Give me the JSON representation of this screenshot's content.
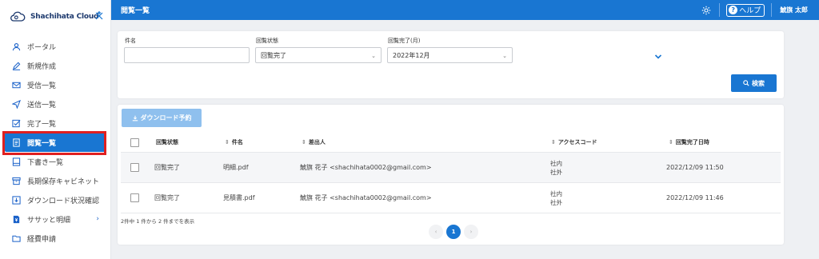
{
  "brand": {
    "name": "Shachihata Cloud"
  },
  "sidebar": {
    "items": [
      {
        "label": "ポータル",
        "icon": "user-icon"
      },
      {
        "label": "新規作成",
        "icon": "pencil-icon"
      },
      {
        "label": "受信一覧",
        "icon": "envelope-icon"
      },
      {
        "label": "送信一覧",
        "icon": "send-icon"
      },
      {
        "label": "完了一覧",
        "icon": "check-square-icon"
      },
      {
        "label": "閲覧一覧",
        "icon": "document-icon"
      },
      {
        "label": "下書き一覧",
        "icon": "draft-icon"
      },
      {
        "label": "長期保存キャビネット",
        "icon": "cabinet-icon"
      },
      {
        "label": "ダウンロード状況確認",
        "icon": "download-box-icon"
      },
      {
        "label": "ササッと明細",
        "icon": "file-yen-icon"
      },
      {
        "label": "経費申請",
        "icon": "folder-icon"
      }
    ],
    "active_index": 5
  },
  "header": {
    "title": "閲覧一覧",
    "help_label": "ヘルプ",
    "user_name": "鯱旗 太郎"
  },
  "search": {
    "subject_label": "件名",
    "subject_value": "",
    "status_label": "回覧状態",
    "status_value": "回覧完了",
    "completed_label": "回覧完了(月)",
    "completed_value": "2022年12月",
    "search_button": "検索"
  },
  "results": {
    "download_button": "ダウンロード予約",
    "columns": [
      "回覧状態",
      "件名",
      "差出人",
      "アクセスコード",
      "回覧完了日時"
    ],
    "rows": [
      {
        "status": "回覧完了",
        "subject": "明細.pdf",
        "sender": "鯱旗 花子 <shachihata0002@gmail.com>",
        "code_line1": "社内",
        "code_line2": "社外",
        "completed_at": "2022/12/09 11:50"
      },
      {
        "status": "回覧完了",
        "subject": "見積書.pdf",
        "sender": "鯱旗 花子 <shachihata0002@gmail.com>",
        "code_line1": "社内",
        "code_line2": "社外",
        "completed_at": "2022/12/09 11:46"
      }
    ],
    "count_text": "2件中 1 件から 2 件までを表示",
    "pagination": {
      "prev": "‹",
      "current": "1",
      "next": "›"
    }
  },
  "colors": {
    "primary": "#1976d2",
    "highlight": "#e02020"
  }
}
